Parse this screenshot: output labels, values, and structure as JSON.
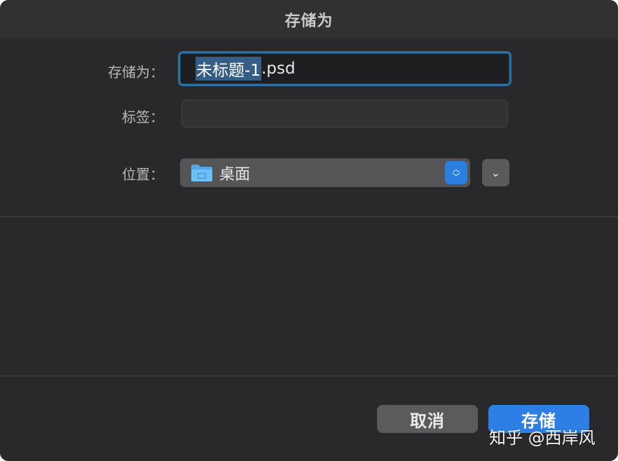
{
  "dialog": {
    "title": "存储为"
  },
  "form": {
    "save_as_label": "存储为：",
    "filename_selected": "未标题-1",
    "filename_rest": ".psd",
    "tags_label": "标签：",
    "tags_value": "",
    "location_label": "位置：",
    "location_value": "桌面",
    "location_icon": "folder-icon"
  },
  "buttons": {
    "cancel_label": "取消",
    "save_label": "存储"
  },
  "watermark": {
    "text": "知乎 @西岸风"
  },
  "colors": {
    "accent": "#2d7fe6",
    "background": "#29292b"
  }
}
